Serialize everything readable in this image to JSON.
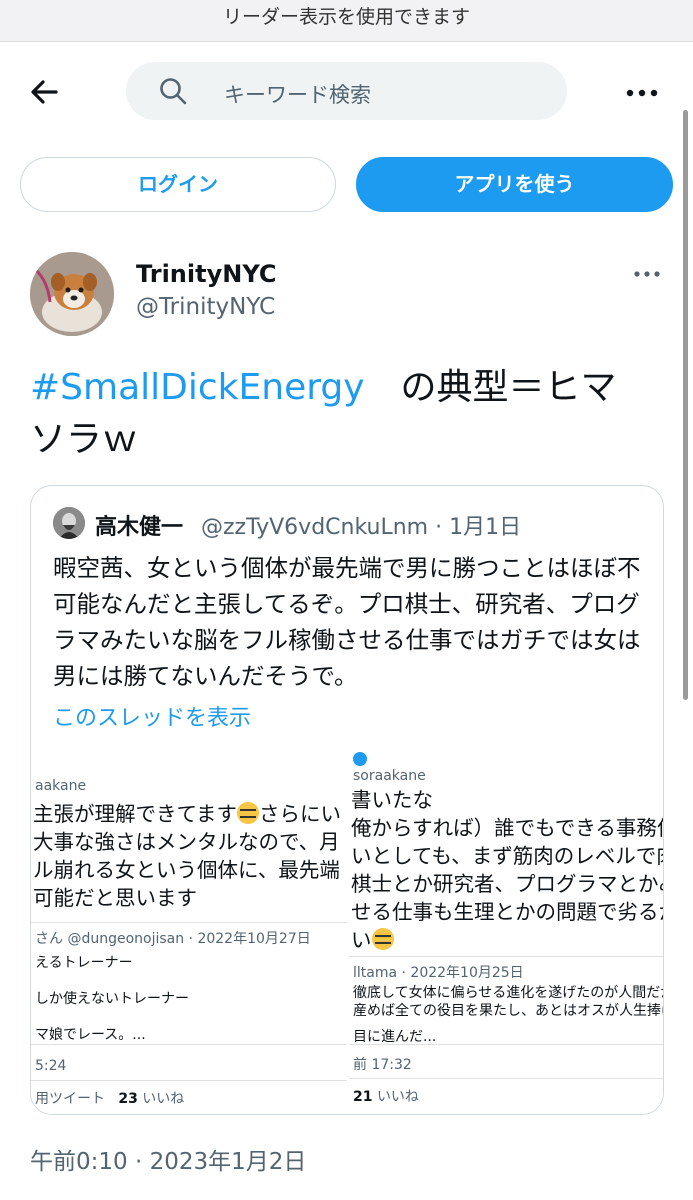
{
  "reader_bar": {
    "text": "リーダー表示を使用できます"
  },
  "search": {
    "placeholder": "キーワード検索"
  },
  "auth": {
    "login_label": "ログイン",
    "app_label": "アプリを使う"
  },
  "icons": {
    "back": "back-arrow-icon",
    "search": "search-icon",
    "more": "more-dots-icon"
  },
  "colors": {
    "accent": "#1d9bf0",
    "text": "#0f1419",
    "muted": "#536471",
    "border": "#cfd9de"
  },
  "post": {
    "author_name": "TrinityNYC",
    "author_handle": "@TrinityNYC",
    "hashtag": "#SmallDickEnergy",
    "text_line1": "　の典型＝ヒマ",
    "text_line2": "ソラｗ",
    "timestamp": "午前0:10 · 2023年1月2日"
  },
  "quote": {
    "name": "高木健一",
    "handle": "@zzTyV6vdCnkuLnm · 1月1日",
    "body": "暇空茜、女という個体が最先端で男に勝つことはほぼ不可能なんだと主張してるぞ。プロ棋士、研究者、プログラマみたいな脳をフル稼働させる仕事ではガチでは女は男には勝てないんだそうで。",
    "thread_link": "このスレッドを表示",
    "left_shot": {
      "handle": "aakane",
      "line1": "主張が理解できてます",
      "line1b": "さらにい",
      "line2": "大事な強さはメンタルなので、月",
      "line3": "ル崩れる女という個体に、最先端",
      "line4": "可能だと思います",
      "quoted_meta": "さん @dungeonojisan · 2022年10月27日",
      "sub1": "えるトレーナー",
      "sub2": "しか使えないトレーナー",
      "sub3": "マ娘でレース。...",
      "time": "5:24",
      "retweet_label": "用ツイート",
      "likes_count": "23",
      "likes_label": "いいね"
    },
    "right_shot": {
      "handle": "soraakane",
      "line1": "書いたな",
      "line2": "俺からすれば）誰でもできる事務作業",
      "line3": "いとしても、まず筋肉のレベルで肉体",
      "line4": "棋士とか研究者、プログラマとかみた",
      "line5": "せる仕事も生理とかの問題で劣るから",
      "line6": "い",
      "quoted_meta": "lltama · 2022年10月25日",
      "sub1": "徹底して女体に偏らせる進化を遂げたのが人間だから",
      "sub2": "産めば全ての役目を果たし、あとはオスが人生捧げて生涯",
      "sub3": "目に進んだ...",
      "time": "前 17:32",
      "likes_count": "21",
      "likes_label": "いいね"
    }
  }
}
